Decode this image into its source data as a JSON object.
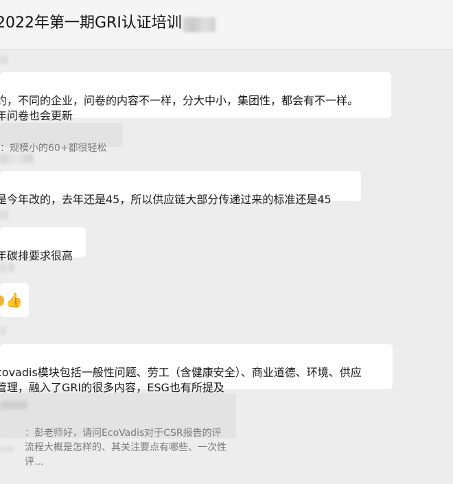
{
  "chat": {
    "title": "2022年第一期GRI认证培训"
  },
  "messages": [
    {
      "text": "约，不同的企业，问卷的内容不一样，分大中小，集团性，都会有不一样。\n年问卷也会更新"
    },
    {
      "quote": "：规模小的60+都很轻松"
    },
    {
      "text": "是今年改的，去年还是45，所以供应链大部分传递过来的标准还是45"
    },
    {
      "text": "年碳排要求很高"
    },
    {
      "emoji": "👍"
    },
    {
      "text": "covadis模块包括一般性问题、劳工（含健康安全）、商业道德、环境、供应\n管理，融入了GRI的很多内容，ESG也有所提及"
    },
    {
      "quote": "：彭老师好，请问EcoVadis对于CSR报告的评\n流程大概是怎样的、其关注要点有哪些、一次性评..."
    }
  ]
}
